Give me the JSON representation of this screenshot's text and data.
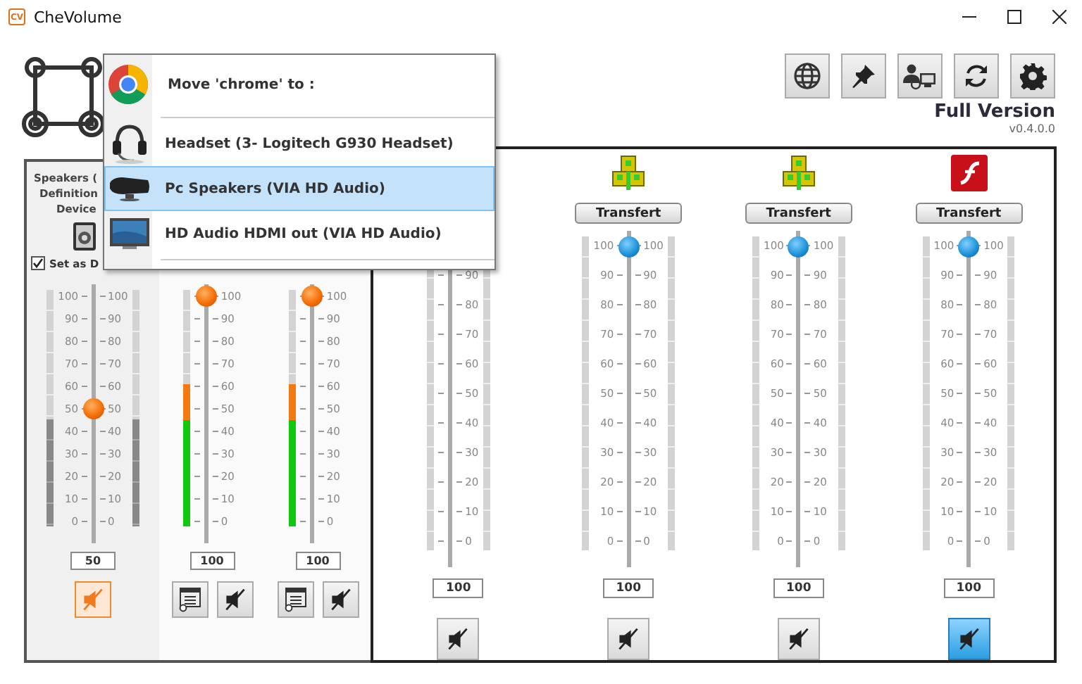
{
  "window": {
    "app_icon": "CV",
    "title": "CheVolume"
  },
  "toolbar": [
    {
      "kind": "globe"
    },
    {
      "kind": "pin"
    },
    {
      "kind": "users"
    },
    {
      "kind": "refresh"
    },
    {
      "kind": "settings"
    }
  ],
  "edition": "Full Version",
  "version": "v0.4.0.0",
  "device_panel": {
    "name_lines": [
      "Speakers (",
      "Definition",
      "Device"
    ],
    "set_default": {
      "label": "Set as D",
      "checked": true
    },
    "master": {
      "level": 0.5,
      "value": "50",
      "left_labels": [
        "100",
        "90",
        "80",
        "70",
        "60",
        "50",
        "40",
        "30",
        "20",
        "10",
        "0"
      ],
      "right_labels": [
        "100",
        "90",
        "80",
        "70",
        "60",
        "50",
        "40",
        "30",
        "20",
        "10",
        "0"
      ],
      "meters": [
        {
          "kind": "gray",
          "level": 0.45
        },
        {
          "kind": "gray",
          "level": 0.45
        }
      ],
      "mute": {
        "muted": false,
        "focused": true
      }
    },
    "apps": [
      {
        "level": 1,
        "value": "100",
        "right_labels": [
          "100",
          "90",
          "80",
          "70",
          "60",
          "50",
          "40",
          "30",
          "20",
          "10",
          "0"
        ],
        "meters": [
          {
            "kind": "color",
            "level": 0.6
          }
        ],
        "mute": {
          "muted": false,
          "focused": false
        }
      },
      {
        "level": 1,
        "value": "100",
        "right_labels": [
          "100",
          "90",
          "80",
          "70",
          "60",
          "50",
          "40",
          "30",
          "20",
          "10",
          "0"
        ],
        "meters": [
          {
            "kind": "color",
            "level": 0.6
          }
        ],
        "mute": {
          "muted": false,
          "focused": false
        }
      }
    ]
  },
  "app_panel": {
    "apps": [
      {
        "value": "100",
        "right_labels": [
          "90",
          "80",
          "70",
          "60",
          "50",
          "40",
          "30",
          "20",
          "10",
          "0"
        ],
        "mute": {
          "muted": false,
          "focused": false
        }
      },
      {
        "kind": "robot",
        "button": "Transfert",
        "level": 1,
        "value": "100",
        "left_labels": [
          "100",
          "90",
          "80",
          "70",
          "60",
          "50",
          "40",
          "30",
          "20",
          "10",
          "0"
        ],
        "right_labels": [
          "100",
          "90",
          "80",
          "70",
          "60",
          "50",
          "40",
          "30",
          "20",
          "10",
          "0"
        ],
        "mute": {
          "muted": false,
          "focused": false
        }
      },
      {
        "kind": "robot",
        "button": "Transfert",
        "level": 1,
        "value": "100",
        "left_labels": [
          "100",
          "90",
          "80",
          "70",
          "60",
          "50",
          "40",
          "30",
          "20",
          "10",
          "0"
        ],
        "right_labels": [
          "100",
          "90",
          "80",
          "70",
          "60",
          "50",
          "40",
          "30",
          "20",
          "10",
          "0"
        ],
        "mute": {
          "muted": false,
          "focused": false
        }
      },
      {
        "kind": "flash",
        "button": "Transfert",
        "level": 1,
        "value": "100",
        "left_labels": [
          "100",
          "90",
          "80",
          "70",
          "60",
          "50",
          "40",
          "30",
          "20",
          "10",
          "0"
        ],
        "right_labels": [
          "100",
          "90",
          "80",
          "70",
          "60",
          "50",
          "40",
          "30",
          "20",
          "10",
          "0"
        ],
        "mute": {
          "muted": true,
          "focused": false
        }
      }
    ]
  },
  "context_menu": {
    "title": "Move 'chrome' to :",
    "items": [
      {
        "kind": "headset",
        "label": "Headset (3- Logitech G930 Headset)",
        "selected": false
      },
      {
        "kind": "speakers",
        "label": "Pc Speakers (VIA HD Audio)",
        "selected": true
      },
      {
        "kind": "monitor",
        "label": "HD Audio HDMI out (VIA HD Audio)",
        "selected": false
      }
    ]
  }
}
